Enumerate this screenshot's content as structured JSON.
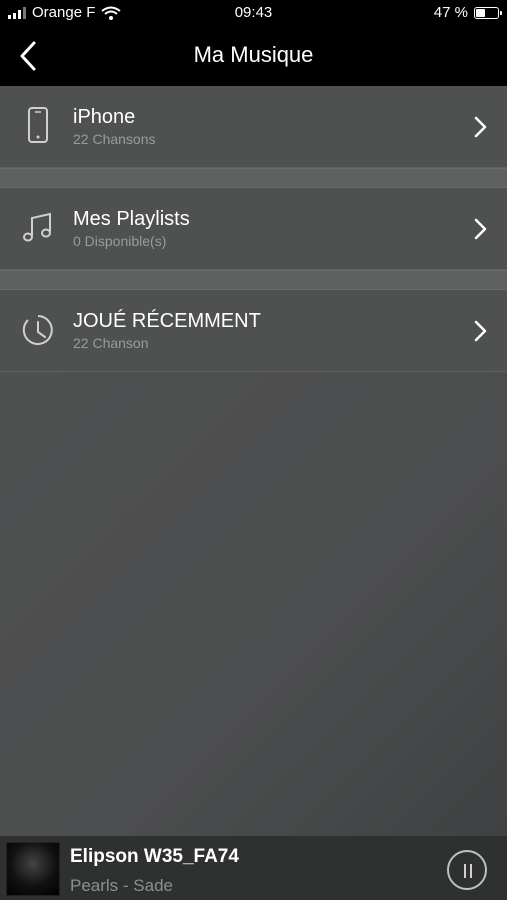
{
  "status": {
    "carrier": "Orange F",
    "time": "09:43",
    "battery_text": "47 %",
    "battery_level": 0.47
  },
  "nav": {
    "title": "Ma Musique",
    "back_icon": "chevron-left-icon"
  },
  "items": [
    {
      "label": "iPhone",
      "sub": "22 Chansons",
      "icon": "phone-icon"
    },
    {
      "label": "Mes Playlists",
      "sub": "0 Disponible(s)",
      "icon": "music-note-icon"
    },
    {
      "label": "JOUÉ RÉCEMMENT",
      "sub": "22 Chanson",
      "icon": "clock-icon"
    }
  ],
  "player": {
    "device": "Elipson W35_FA74",
    "track": "Pearls - Sade",
    "control_icon": "pause-icon"
  }
}
